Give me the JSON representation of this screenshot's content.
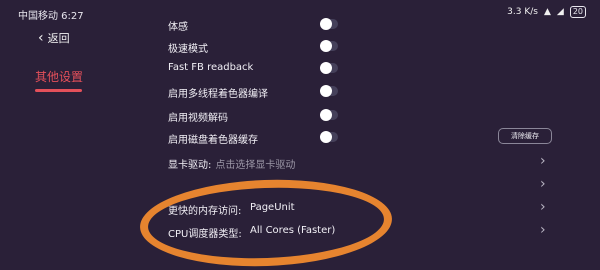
{
  "status": {
    "carrier_time": "中国移动 6:27",
    "speed": "3.3 K/s",
    "battery": "20"
  },
  "sidebar": {
    "back_label": "返回",
    "active_item": "其他设置",
    "accent_color": "#e4505a"
  },
  "settings": [
    {
      "label": "体感"
    },
    {
      "label": "极速模式"
    },
    {
      "label": "Fast FB readback"
    },
    {
      "label": "启用多线程着色器编译"
    },
    {
      "label": "启用视频解码"
    },
    {
      "label": "启用磁盘着色器缓存",
      "button": "清除缓存"
    }
  ],
  "links": {
    "gpu_driver_label": "显卡驱动:",
    "gpu_driver_hint": "点击选择显卡驱动",
    "memory_label": "更快的内存访问:",
    "memory_value": "PageUnit",
    "cpu_label": "CPU调度器类型:",
    "cpu_value": "All Cores (Faster)"
  },
  "annotation_color": "#f08a2e"
}
